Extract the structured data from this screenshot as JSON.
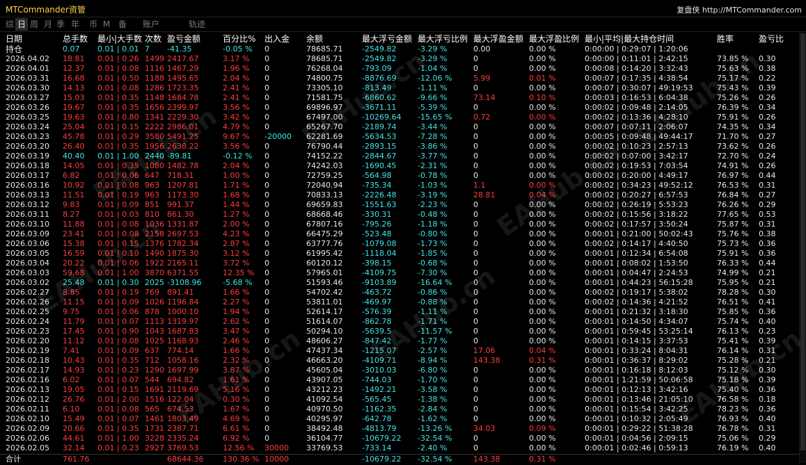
{
  "app_title": "MTCommander资管",
  "brand": {
    "name": "复盘侠",
    "url": "http://MTCommander.com"
  },
  "tabs": [
    "综",
    "日",
    "周",
    "月",
    "季",
    "年",
    "币",
    "M",
    "备",
    "账户",
    "轨迹"
  ],
  "active_tab": 1,
  "colors": {
    "white": "#e8e8e8",
    "red": "#ff3b3b",
    "cyan": "#40e6e6",
    "yellow": "#ffd24a",
    "bg": "#000000"
  },
  "headers": [
    "日期",
    "总手数",
    "最小|大手数",
    "次数",
    "盈亏金额",
    "百分比%",
    "出入金",
    "余额",
    "最大浮亏金额",
    "最大浮亏比例",
    "最大浮盈金额",
    "最大浮盈比例",
    "最小|平均|最大持仓时间",
    "胜率",
    "盈亏比"
  ],
  "hold": {
    "label": "持仓",
    "lots": "0.07",
    "minmax": "0.01 | 0.01",
    "count": "7",
    "pnl": "-41.35",
    "pct": "-0.05 %",
    "io": "0",
    "bal": "78685.71",
    "mfl": "-2549.82",
    "mflp": "-3.29 %",
    "mfp": "0.00",
    "mfpp": "0.00 %",
    "time": "0:00:00 | 0:29:07 | 1:20:06",
    "win": "",
    "rr": ""
  },
  "rows": [
    [
      "2026.04.02",
      "18.81",
      "0.01 | 0.26",
      "1499",
      "2417.67",
      "3.17 %",
      "0",
      "78685.71",
      "-2549.82",
      "-3.29 %",
      "0",
      "0.00 %",
      "0:00:00 | 0:11:01 | 2:42:15",
      "73.85 %",
      "0.30"
    ],
    [
      "2026.04.01",
      "12.37",
      "0.01 | 0.08",
      "1116",
      "1467.29",
      "1.96 %",
      "0",
      "76268.04",
      "-793.09",
      "-1.04 %",
      "0",
      "0.00 %",
      "0:00:08 | 0:14:20 | 3:32:43",
      "75.63 %",
      "0.38"
    ],
    [
      "2026.03.31",
      "16.68",
      "0.01 | 0.50",
      "1188",
      "1495.65",
      "2.04 %",
      "0",
      "74800.75",
      "-8876.69",
      "-12.06 %",
      "5.99",
      "0.01 %",
      "0:00:07 | 0:17:35 | 4:38:54",
      "75.17 %",
      "0.22"
    ],
    [
      "2026.03.30",
      "14.13",
      "0.01 | 0.08",
      "1286",
      "1723.35",
      "2.41 %",
      "0",
      "73305.10",
      "-813.49",
      "-1.11 %",
      "0",
      "0.00 %",
      "0:00:07 | 0:30:07 | 49:19:53",
      "75.43 %",
      "0.39"
    ],
    [
      "2026.03.27",
      "15.03",
      "0.01 | 0.35",
      "1148",
      "1684.78",
      "2.41 %",
      "0",
      "71581.75",
      "-6860.62",
      "-9.66 %",
      "73.14",
      "0.10 %",
      "0:00:03 | 0:16:53 | 6:04:38",
      "75.26 %",
      "0.26"
    ],
    [
      "2026.03.26",
      "19.67",
      "0.01 | 0.35",
      "1656",
      "2399.97",
      "3.56 %",
      "0",
      "69896.97",
      "-3671.11",
      "-5.39 %",
      "0",
      "0.00 %",
      "0:00:02 | 0:09:48 | 2:14:05",
      "76.39 %",
      "0.34"
    ],
    [
      "2026.03.25",
      "19.63",
      "0.01 | 0.80",
      "1341",
      "2229.30",
      "3.42 %",
      "0",
      "67497.00",
      "-10269.64",
      "-15.65 %",
      "0.72",
      "0.00 %",
      "0:00:02 | 0:13:36 | 4:28:10",
      "75.91 %",
      "0.26"
    ],
    [
      "2026.03.24",
      "25.04",
      "0.01 | 0.15",
      "2222",
      "2986.01",
      "4.79 %",
      "0",
      "65267.70",
      "-2189.74",
      "-3.44 %",
      "0",
      "0.00 %",
      "0:00:07 | 0:07:11 | 2:06:07",
      "74.35 %",
      "0.34"
    ],
    [
      "2026.03.23",
      "45.78",
      "0.01 | 0.29",
      "3580",
      "5491.25",
      "9.67 %",
      "-20000",
      "62281.69",
      "-5634.53",
      "-7.28 %",
      "0",
      "0.00 %",
      "0:00:05 | 0:09:48 | 49:44:17",
      "71.70 %",
      "0.27"
    ],
    [
      "2026.03.20",
      "26.40",
      "0.01 | 0.35",
      "1956",
      "2638.22",
      "3.56 %",
      "0",
      "76790.44",
      "-2893.15",
      "-3.86 %",
      "0",
      "0.00 %",
      "0:00:02 | 0:10:23 | 2:57:13",
      "73.62 %",
      "0.26"
    ],
    [
      "2026.03.19",
      "40.40",
      "0.01 | 1.00",
      "2440",
      "-89.81",
      "-0.12 %",
      "0",
      "74152.22",
      "-2844.67",
      "-3.77 %",
      "0",
      "0.00 %",
      "0:00:02 | 0:07:00 | 3:42:17",
      "72.70 %",
      "0.24"
    ],
    [
      "2026.03.18",
      "14.05",
      "0.01 | 0.35",
      "1080",
      "1482.78",
      "2.04 %",
      "0",
      "74242.03",
      "-1690.45",
      "-2.31 %",
      "0",
      "0.00 %",
      "0:00:02 | 0:19:53 | 7:03:54",
      "74.91 %",
      "0.26"
    ],
    [
      "2026.03.17",
      "6.82",
      "0.01 | 0.06",
      "647",
      "718.31",
      "1.00 %",
      "0",
      "72759.25",
      "-564.98",
      "-0.78 %",
      "0",
      "0.00 %",
      "0:00:02 | 0:20:00 | 4:49:17",
      "76.97 %",
      "0.44"
    ],
    [
      "2026.03.16",
      "10.92",
      "0.01 | 0.08",
      "963",
      "1207.81",
      "1.71 %",
      "0",
      "72040.94",
      "-735.34",
      "-1.03 %",
      "1.1",
      "0.00 %",
      "0:00:02 | 0:34:23 | 49:52:12",
      "76.53 %",
      "0.31"
    ],
    [
      "2026.03.13",
      "11.51",
      "0.01 | 0.19",
      "963",
      "1173.30",
      "1.68 %",
      "0",
      "70833.13",
      "-2226.48",
      "-3.19 %",
      "28.81",
      "0.04 %",
      "0:00:02 | 0:20:27 | 6:57:53",
      "76.84 %",
      "0.27"
    ],
    [
      "2026.03.12",
      "9.83",
      "0.01 | 0.09",
      "851",
      "991.37",
      "1.44 %",
      "0",
      "69659.83",
      "-1551.63",
      "-2.23 %",
      "0",
      "0.00 %",
      "0:00:02 | 0:26:19 | 5:53:23",
      "76.26 %",
      "0.29"
    ],
    [
      "2026.03.11",
      "8.27",
      "0.01 | 0.03",
      "810",
      "861.30",
      "1.27 %",
      "0",
      "68668.46",
      "-330.31",
      "-0.48 %",
      "0",
      "0.00 %",
      "0:00:02 | 0:15:56 | 3:18:22",
      "77.65 %",
      "0.53"
    ],
    [
      "2026.03.10",
      "11.88",
      "0.01 | 0.08",
      "1036",
      "1331.87",
      "2.00 %",
      "0",
      "67807.16",
      "-795.26",
      "-1.18 %",
      "0",
      "0.00 %",
      "0:00:02 | 0:17:57 | 3:50:24",
      "75.87 %",
      "0.31"
    ],
    [
      "2026.03.09",
      "23.41",
      "0.01 | 0.08",
      "2158",
      "2697.53",
      "4.23 %",
      "0",
      "66475.29",
      "-523.48",
      "-0.80 %",
      "0",
      "0.00 %",
      "0:00:01 | 0:21:00 | 50:02:43",
      "75.76 %",
      "0.38"
    ],
    [
      "2026.03.06",
      "15.38",
      "0.01 | 0.15",
      "1376",
      "1782.34",
      "2.87 %",
      "0",
      "63777.76",
      "-1079.08",
      "-1.73 %",
      "0",
      "0.00 %",
      "0:00:02 | 0:14:17 | 4:40:50",
      "75.73 %",
      "0.36"
    ],
    [
      "2026.03.05",
      "16.59",
      "0.01 | 0.10",
      "1490",
      "1875.30",
      "3.12 %",
      "0",
      "61995.42",
      "-1118.04",
      "-1.85 %",
      "0",
      "0.00 %",
      "0:00:01 | 0:12:34 | 6:54:08",
      "75.91 %",
      "0.36"
    ],
    [
      "2026.03.04",
      "20.22",
      "0.01 | 0.06",
      "1922",
      "2165.11",
      "3.72 %",
      "0",
      "60120.12",
      "-398.15",
      "-0.68 %",
      "0",
      "0.00 %",
      "0:00:01 | 0:08:02 | 1:53:50",
      "76.33 %",
      "0.44"
    ],
    [
      "2026.03.03",
      "59.68",
      "0.01 | 1.00",
      "3870",
      "6371.55",
      "12.35 %",
      "0",
      "57965.01",
      "-4109.75",
      "-7.30 %",
      "0",
      "0.00 %",
      "0:00:01 | 0:04:47 | 2:24:53",
      "74.99 %",
      "0.21"
    ],
    [
      "2026.03.02",
      "25.48",
      "0.01 | 0.30",
      "2025",
      "-3108.96",
      "-5.68 %",
      "0",
      "51593.46",
      "-9103.89",
      "-16.64 %",
      "0",
      "0.00 %",
      "0:00:01 | 0:44:23 | 56:15:28",
      "75.95 %",
      "0.21"
    ],
    [
      "2026.02.27",
      "8.85",
      "0.01 | 0.19",
      "769",
      "891.41",
      "1.66 %",
      "0",
      "54702.42",
      "-463.72",
      "-0.86 %",
      "0",
      "0.00 %",
      "0:00:02 | 0:19:17 | 5:38:02",
      "78.28 %",
      "0.30"
    ],
    [
      "2026.02.26",
      "11.15",
      "0.01 | 0.09",
      "1026",
      "1196.84",
      "2.27 %",
      "0",
      "53811.01",
      "-469.97",
      "-0.88 %",
      "0",
      "0.00 %",
      "0:00:02 | 0:14:36 | 4:21:52",
      "76.51 %",
      "0.41"
    ],
    [
      "2026.02.25",
      "9.75",
      "0.01 | 0.06",
      "878",
      "1000.10",
      "1.94 %",
      "0",
      "52614.17",
      "-576.39",
      "-1.11 %",
      "0",
      "0.00 %",
      "0:00:01 | 0:21:32 | 3:18:30",
      "75.85 %",
      "0.36"
    ],
    [
      "2026.02.24",
      "11.79",
      "0.01 | 0.07",
      "1113",
      "1319.97",
      "2.62 %",
      "0",
      "51614.07",
      "-862.78",
      "-1.71 %",
      "0",
      "0.00 %",
      "0:00:01 | 0:14:50 | 4:34:07",
      "75.74 %",
      "0.40"
    ],
    [
      "2026.02.23",
      "17.45",
      "0.01 | 0.90",
      "1043",
      "1687.83",
      "3.47 %",
      "0",
      "50294.10",
      "-5639.5",
      "-11.57 %",
      "0",
      "0.00 %",
      "0:00:01 | 0:59:45 | 53:25:14",
      "76.13 %",
      "0.23"
    ],
    [
      "2026.02.20",
      "11.12",
      "0.01 | 0.08",
      "1025",
      "1168.93",
      "2.46 %",
      "0",
      "48606.27",
      "-847.42",
      "-1.77 %",
      "0",
      "0.00 %",
      "0:00:01 | 0:14:15 | 3:37:53",
      "75.41 %",
      "0.39"
    ],
    [
      "2026.02.19",
      "7.41",
      "0.01 | 0.09",
      "637",
      "774.14",
      "1.66 %",
      "0",
      "47437.34",
      "-1215.07",
      "-2.57 %",
      "17.06",
      "0.04 %",
      "0:00:01 | 0:33:24 | 8:04:31",
      "76.14 %",
      "0.31"
    ],
    [
      "2026.02.18",
      "10.43",
      "0.01 | 0.35",
      "712",
      "1058.16",
      "2.32 %",
      "0",
      "46663.20",
      "-4109.71",
      "-8.94 %",
      "143.38",
      "0.31 %",
      "0:00:01 | 0:36:37 | 8:29:02",
      "75.28 %",
      "0.21"
    ],
    [
      "2026.02.17",
      "14.93",
      "0.01 | 0.23",
      "1290",
      "1697.99",
      "3.87 %",
      "0",
      "45605.04",
      "-3010.03",
      "-6.80 %",
      "0",
      "0.00 %",
      "0:00:01 | 0:16:18 | 8:12:03",
      "75.12 %",
      "0.30"
    ],
    [
      "2026.02.16",
      "6.02",
      "0.01 | 0.07",
      "544",
      "694.82",
      "1.61 %",
      "0",
      "43907.05",
      "-744.03",
      "-1.70 %",
      "0",
      "0.00 %",
      "0:00:01 | 1:21:59 | 50:06:58",
      "75.18 %",
      "0.39"
    ],
    [
      "2026.02.13",
      "19.05",
      "0.01 | 0.15",
      "1691",
      "2119.69",
      "5.16 %",
      "0",
      "43212.23",
      "-1492.21",
      "-3.58 %",
      "0",
      "0.00 %",
      "0:00:01 | 0:12:13 | 3:42:16",
      "75.40 %",
      "0.36"
    ],
    [
      "2026.02.12",
      "26.76",
      "0.01 | 2.00",
      "1516",
      "122.04",
      "0.30 %",
      "0",
      "41092.54",
      "-565.45",
      "-1.38 %",
      "0",
      "0.00 %",
      "0:00:01 | 0:13:46 | 21:05:10",
      "76.58 %",
      "0.18"
    ],
    [
      "2026.02.11",
      "6.10",
      "0.01 | 0.08",
      "565",
      "674.53",
      "1.67 %",
      "0",
      "40970.50",
      "-1162.35",
      "-2.84 %",
      "0",
      "0.00 %",
      "0:00:01 | 0:15:54 | 3:42:25",
      "78.23 %",
      "0.36"
    ],
    [
      "2026.02.10",
      "15.49",
      "0.01 | 0.07",
      "1461",
      "1803.49",
      "4.69 %",
      "0",
      "40295.97",
      "-642.78",
      "-1.62 %",
      "0",
      "0.00 %",
      "0:00:01 | 0:10:32 | 2:05:49",
      "76.93 %",
      "0.40"
    ],
    [
      "2026.02.09",
      "20.66",
      "0.01 | 0.35",
      "1731",
      "2387.71",
      "6.61 %",
      "0",
      "38492.48",
      "-4813.79",
      "-13.26 %",
      "34.03",
      "0.09 %",
      "0:00:01 | 0:29:22 | 51:38:28",
      "76.78 %",
      "0.31"
    ],
    [
      "2026.02.06",
      "44.61",
      "0.01 | 1.00",
      "3228",
      "2335.24",
      "6.92 %",
      "0",
      "36104.77",
      "-10679.22",
      "-32.54 %",
      "0",
      "0.00 %",
      "0:00:01 | 0:04:56 | 2:09:15",
      "75.06 %",
      "0.29"
    ],
    [
      "2026.02.05",
      "32.14",
      "0.01 | 0.23",
      "2927",
      "3769.53",
      "12.56 %",
      "30000",
      "33769.53",
      "-733.14",
      "-2.40 %",
      "0",
      "0.00 %",
      "0:00:01 | 0:02:46 | 0:59:13",
      "76.19 %",
      "0.40"
    ]
  ],
  "total": {
    "label": "合计",
    "lots": "761.76",
    "pnl": "68644.36",
    "pct": "130.36 %",
    "io": "10000",
    "mfl": "-10679.22",
    "mflp": "-32.54 %",
    "mfp": "143.38",
    "mfpp": "0.31 %"
  },
  "watermark": "EAHub.cn"
}
